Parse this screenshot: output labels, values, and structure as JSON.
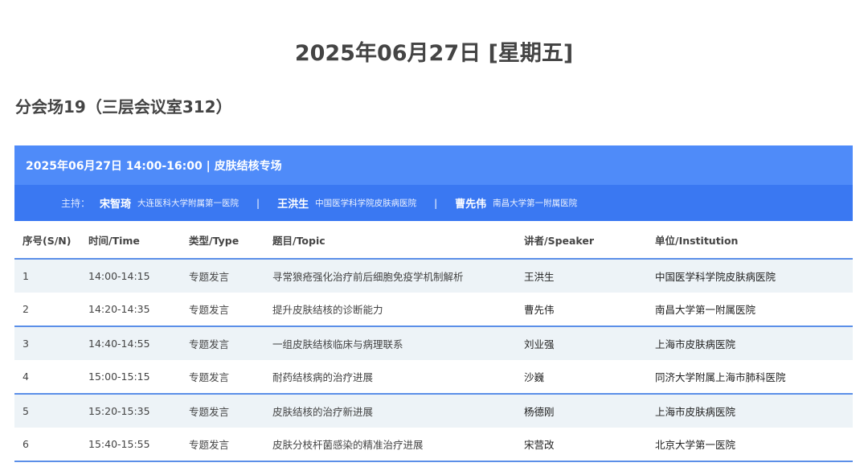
{
  "page": {
    "date_title": "2025年06月27日 [星期五]",
    "venue_title": "分会场19（三层会议室312）"
  },
  "session": {
    "header": "2025年06月27日 14:00-16:00 | 皮肤结核专场",
    "host_label": "主持：",
    "separator": "|",
    "hosts": [
      {
        "name": "宋智琦",
        "institution": "大连医科大学附属第一医院"
      },
      {
        "name": "王洪生",
        "institution": "中国医学科学院皮肤病医院"
      },
      {
        "name": "曹先伟",
        "institution": "南昌大学第一附属医院"
      }
    ]
  },
  "table": {
    "columns": [
      "序号(S/N)",
      "时间/Time",
      "类型/Type",
      "题目/Topic",
      "讲者/Speaker",
      "单位/Institution"
    ],
    "rows": [
      {
        "sn": "1",
        "time": "14:00-14:15",
        "type": "专题发言",
        "topic": "寻常狼疮强化治疗前后细胞免疫学机制解析",
        "speaker": "王洪生",
        "institution": "中国医学科学院皮肤病医院"
      },
      {
        "sn": "2",
        "time": "14:20-14:35",
        "type": "专题发言",
        "topic": "提升皮肤结核的诊断能力",
        "speaker": "曹先伟",
        "institution": "南昌大学第一附属医院"
      },
      {
        "sn": "3",
        "time": "14:40-14:55",
        "type": "专题发言",
        "topic": "一组皮肤结核临床与病理联系",
        "speaker": "刘业强",
        "institution": "上海市皮肤病医院"
      },
      {
        "sn": "4",
        "time": "15:00-15:15",
        "type": "专题发言",
        "topic": "耐药结核病的治疗进展",
        "speaker": "沙巍",
        "institution": "同济大学附属上海市肺科医院"
      },
      {
        "sn": "5",
        "time": "15:20-15:35",
        "type": "专题发言",
        "topic": "皮肤结核的治疗新进展",
        "speaker": "杨德刚",
        "institution": "上海市皮肤病医院"
      },
      {
        "sn": "6",
        "time": "15:40-15:55",
        "type": "专题发言",
        "topic": "皮肤分枝杆菌感染的精准治疗进展",
        "speaker": "宋营改",
        "institution": "北京大学第一医院"
      }
    ]
  },
  "colors": {
    "header_blue": "#4f8bf9",
    "host_bar_blue": "#3a78f2",
    "row_shade": "#edf3f7",
    "divider_blue": "#5b8fe8"
  }
}
